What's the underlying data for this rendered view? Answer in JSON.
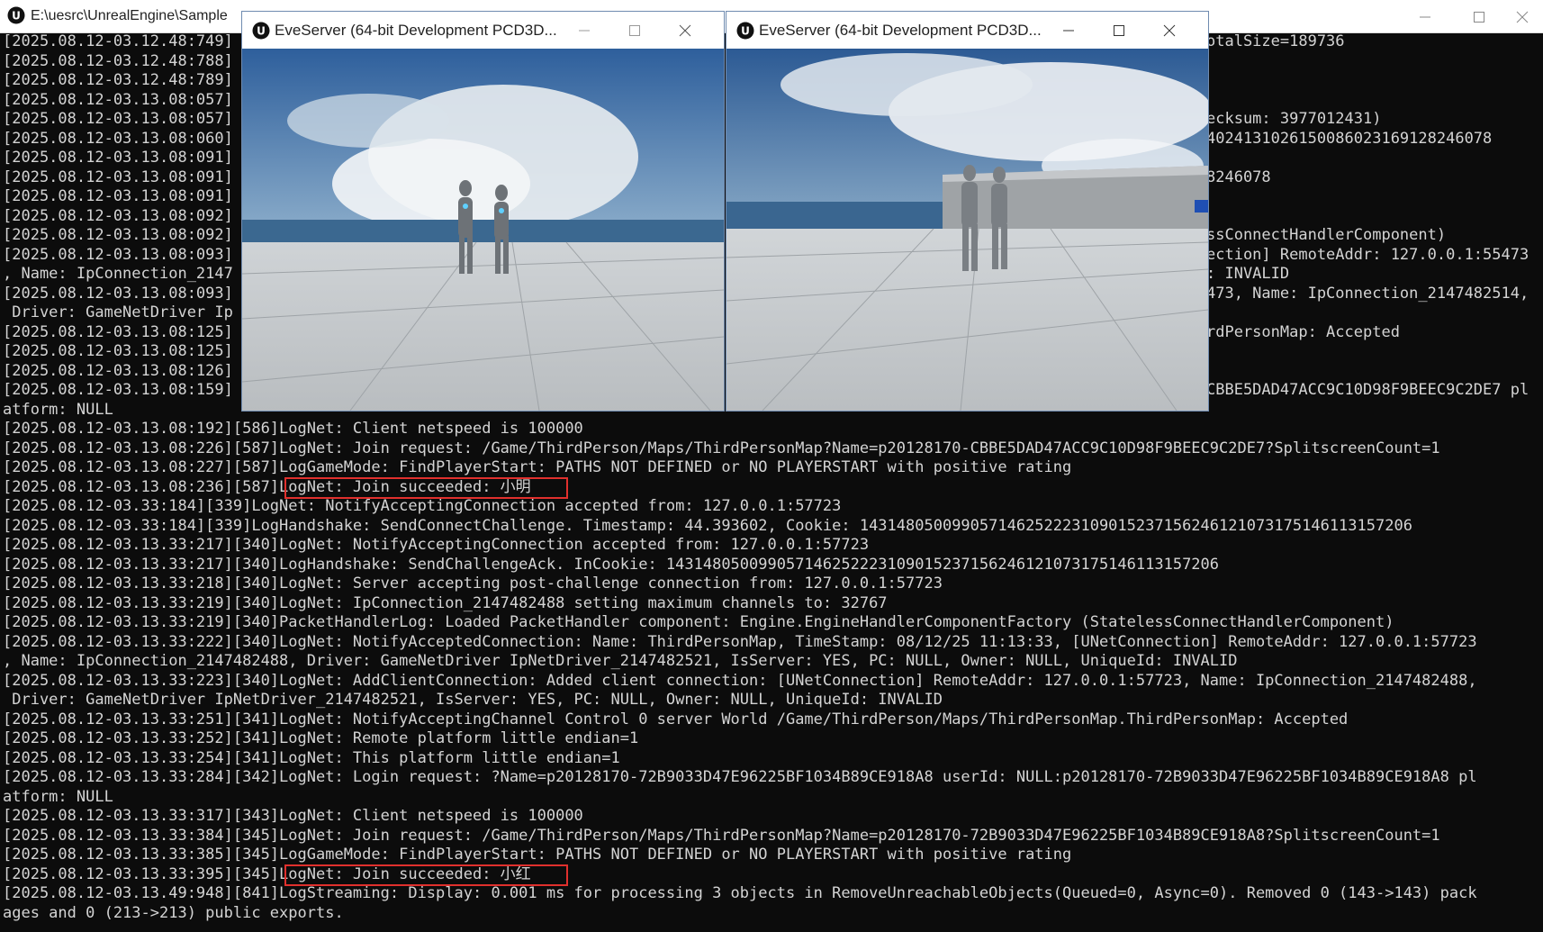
{
  "console": {
    "title": "E:\\uesrc\\UnrealEngine\\Sample",
    "lines": [
      "[2025.08.12-03.12.48:749]",
      "[2025.08.12-03.12.48:788]",
      "[2025.08.12-03.12.48:789]",
      "[2025.08.12-03.13.08:057]",
      "[2025.08.12-03.13.08:057]",
      "[2025.08.12-03.13.08:060]",
      "[2025.08.12-03.13.08:091]",
      "[2025.08.12-03.13.08:091]",
      "[2025.08.12-03.13.08:091]",
      "[2025.08.12-03.13.08:092]",
      "[2025.08.12-03.13.08:092]",
      "[2025.08.12-03.13.08:093]",
      ", Name: IpConnection_2147",
      "[2025.08.12-03.13.08:093]",
      " Driver: GameNetDriver Ip",
      "[2025.08.12-03.13.08:125]",
      "[2025.08.12-03.13.08:125]",
      "[2025.08.12-03.13.08:126]",
      "[2025.08.12-03.13.08:159]",
      "atform: NULL",
      "[2025.08.12-03.13.08:192][586]LogNet: Client netspeed is 100000",
      "[2025.08.12-03.13.08:226][587]LogNet: Join request: /Game/ThirdPerson/Maps/ThirdPersonMap?Name=p20128170-CBBE5DAD47ACC9C10D98F9BEEC9C2DE7?SplitscreenCount=1",
      "[2025.08.12-03.13.08:227][587]LogGameMode: FindPlayerStart: PATHS NOT DEFINED or NO PLAYERSTART with positive rating",
      "[2025.08.12-03.13.08:236][587]LogNet: Join succeeded: 小明",
      "[2025.08.12-03.33:184][339]LogNet: NotifyAcceptingConnection accepted from: 127.0.0.1:57723",
      "[2025.08.12-03.33:184][339]LogHandshake: SendConnectChallenge. Timestamp: 44.393602, Cookie: 143148050099057146252223109015237156246121073175146113157206",
      "[2025.08.12-03.13.33:217][340]LogNet: NotifyAcceptingConnection accepted from: 127.0.0.1:57723",
      "[2025.08.12-03.13.33:217][340]LogHandshake: SendChallengeAck. InCookie: 143148050099057146252223109015237156246121073175146113157206",
      "[2025.08.12-03.13.33:218][340]LogNet: Server accepting post-challenge connection from: 127.0.0.1:57723",
      "[2025.08.12-03.13.33:219][340]LogNet: IpConnection_2147482488 setting maximum channels to: 32767",
      "[2025.08.12-03.13.33:219][340]PacketHandlerLog: Loaded PacketHandler component: Engine.EngineHandlerComponentFactory (StatelessConnectHandlerComponent)",
      "[2025.08.12-03.13.33:222][340]LogNet: NotifyAcceptedConnection: Name: ThirdPersonMap, TimeStamp: 08/12/25 11:13:33, [UNetConnection] RemoteAddr: 127.0.0.1:57723",
      ", Name: IpConnection_2147482488, Driver: GameNetDriver IpNetDriver_2147482521, IsServer: YES, PC: NULL, Owner: NULL, UniqueId: INVALID",
      "[2025.08.12-03.13.33:223][340]LogNet: AddClientConnection: Added client connection: [UNetConnection] RemoteAddr: 127.0.0.1:57723, Name: IpConnection_2147482488,",
      " Driver: GameNetDriver IpNetDriver_2147482521, IsServer: YES, PC: NULL, Owner: NULL, UniqueId: INVALID",
      "[2025.08.12-03.13.33:251][341]LogNet: NotifyAcceptingChannel Control 0 server World /Game/ThirdPerson/Maps/ThirdPersonMap.ThirdPersonMap: Accepted",
      "[2025.08.12-03.13.33:252][341]LogNet: Remote platform little endian=1",
      "[2025.08.12-03.13.33:254][341]LogNet: This platform little endian=1",
      "[2025.08.12-03.13.33:284][342]LogNet: Login request: ?Name=p20128170-72B9033D47E96225BF1034B89CE918A8 userId: NULL:p20128170-72B9033D47E96225BF1034B89CE918A8 pl",
      "atform: NULL",
      "[2025.08.12-03.13.33:317][343]LogNet: Client netspeed is 100000",
      "[2025.08.12-03.13.33:384][345]LogNet: Join request: /Game/ThirdPerson/Maps/ThirdPersonMap?Name=p20128170-72B9033D47E96225BF1034B89CE918A8?SplitscreenCount=1",
      "[2025.08.12-03.13.33:385][345]LogGameMode: FindPlayerStart: PATHS NOT DEFINED or NO PLAYERSTART with positive rating",
      "[2025.08.12-03.13.33:395][345]LogNet: Join succeeded: 小红",
      "[2025.08.12-03.13.49:948][841]LogStreaming: Display: 0.001 ms for processing 3 objects in RemoveUnreachableObjects(Queued=0, Async=0). Removed 0 (143->143) pack",
      "ages and 0 (213->213) public exports."
    ],
    "right_fragments": [
      "otalSize=189736",
      "ecksum: 3977012431)",
      "4024131026150086023169128246078",
      "8246078",
      "ssConnectHandlerComponent)",
      "ection] RemoteAddr: 127.0.0.1:55473",
      ": INVALID",
      "473, Name: IpConnection_2147482514,",
      "rdPersonMap: Accepted",
      "CBBE5DAD47ACC9C10D98F9BEEC9C2DE7 pl"
    ]
  },
  "game_windows": [
    {
      "title": "EveServer (64-bit Development PCD3D..."
    },
    {
      "title": "EveServer (64-bit Development PCD3D..."
    }
  ],
  "colors": {
    "console_bg": "#0c0c0c",
    "console_text": "#d4d4d4",
    "highlight": "#e0302d"
  }
}
